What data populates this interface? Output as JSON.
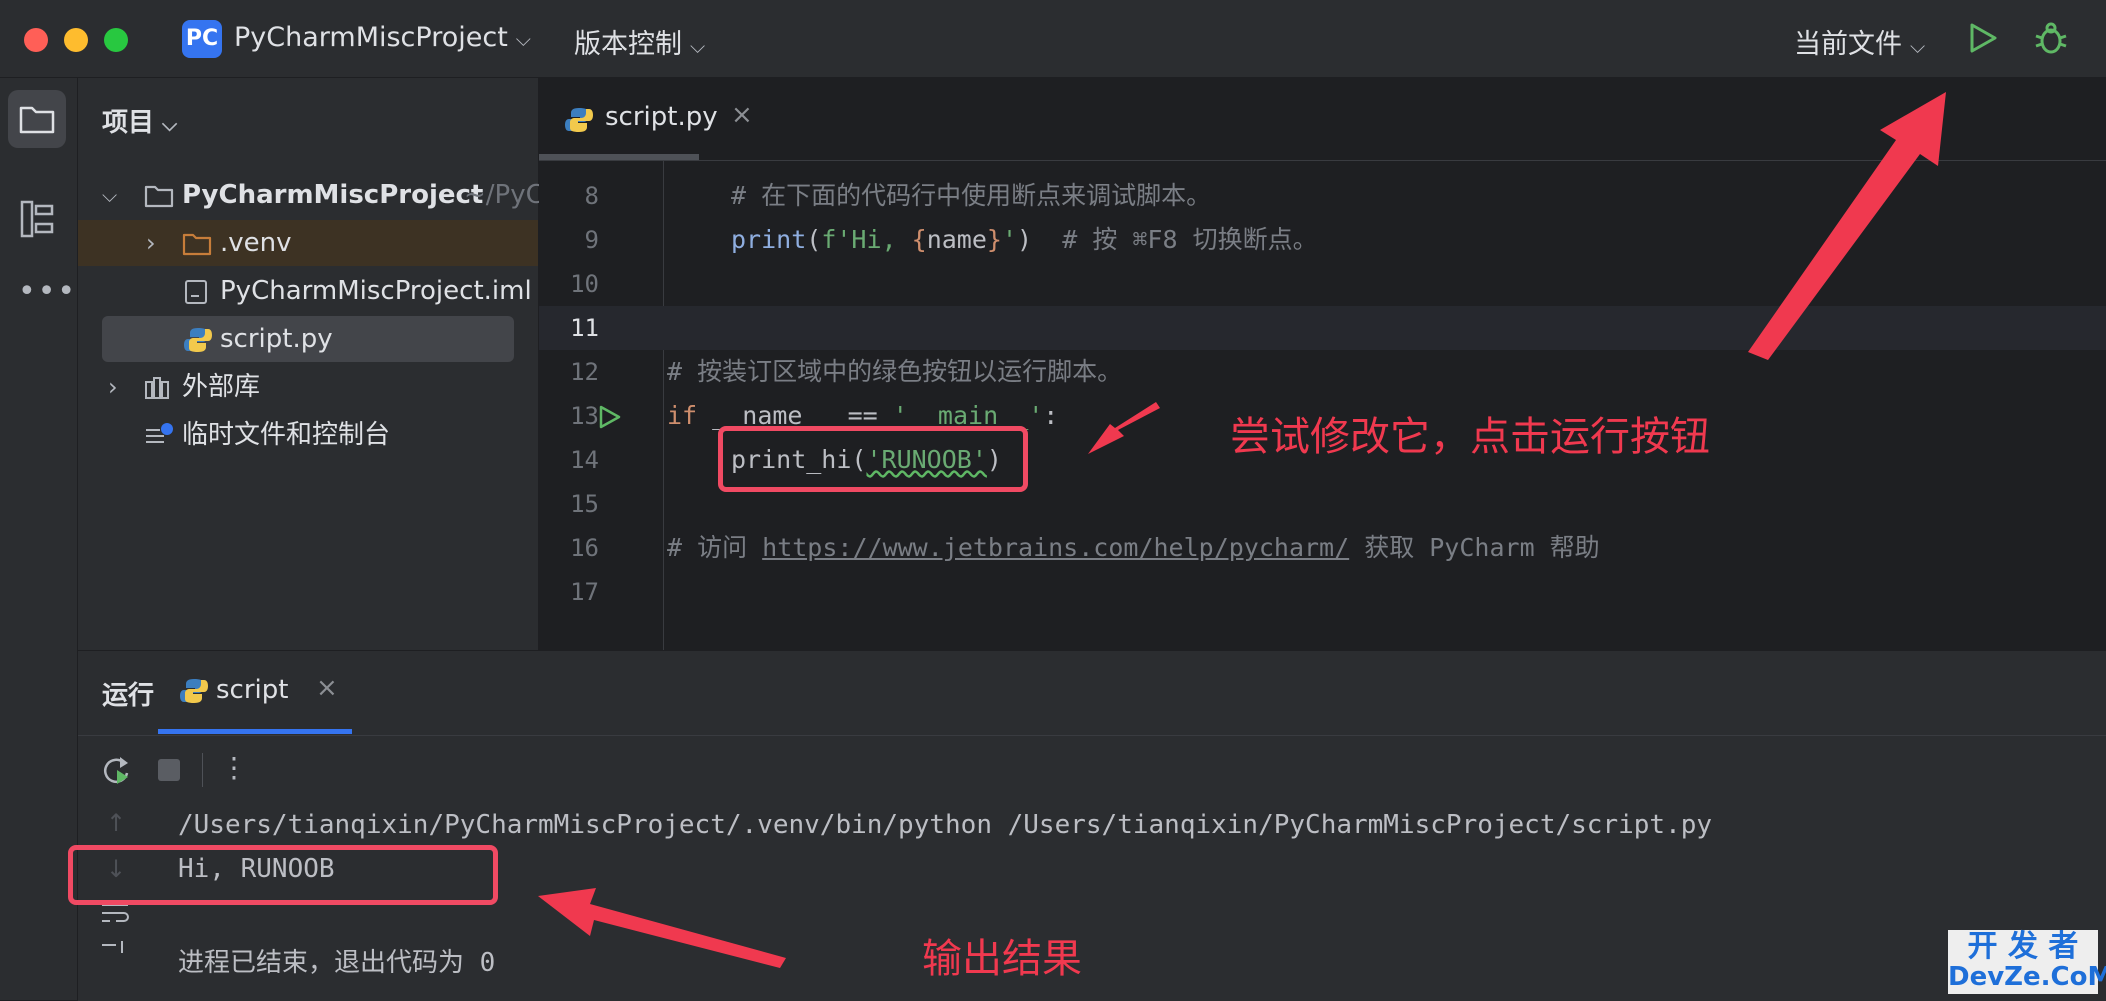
{
  "titlebar": {
    "project_badge": "PC",
    "project_name": "PyCharmMiscProject",
    "vcs_label": "版本控制",
    "run_config": "当前文件"
  },
  "project_panel": {
    "title": "项目",
    "tree": {
      "root_name": "PyCharmMiscProject",
      "root_path": "~/PyC",
      "venv": ".venv",
      "iml_file": "PyCharmMiscProject.iml",
      "script_file": "script.py",
      "external_libs": "外部库",
      "scratches": "临时文件和控制台"
    }
  },
  "editor": {
    "tab_label": "script.py",
    "lines": [
      {
        "num": "8",
        "text": "# 在下面的代码行中使用断点来调试脚本。"
      },
      {
        "num": "9",
        "pre": "print",
        "open": "(",
        "str1": "f'Hi, ",
        "b1": "{",
        "var": "name",
        "b2": "}",
        "str2": "'",
        "close": ")",
        "comment": "  # 按 ⌘F8 切换断点。"
      },
      {
        "num": "10",
        "text": ""
      },
      {
        "num": "11",
        "text": ""
      },
      {
        "num": "12",
        "text": "# 按装订区域中的绿色按钮以运行脚本。"
      },
      {
        "num": "13",
        "kw": "if",
        "rest1": " __name__ == ",
        "str": "'__main__'",
        "rest2": ":"
      },
      {
        "num": "14",
        "fn": "print_hi(",
        "str": "'RUNOOB'",
        "close": ")"
      },
      {
        "num": "15",
        "text": ""
      },
      {
        "num": "16",
        "pre": "# 访问 ",
        "link": "https://www.jetbrains.com/help/pycharm/",
        "post": " 获取 PyCharm 帮助"
      },
      {
        "num": "17",
        "text": ""
      }
    ]
  },
  "run_panel": {
    "title": "运行",
    "tab_label": "script",
    "console": {
      "command": "/Users/tianqixin/PyCharmMiscProject/.venv/bin/python /Users/tianqixin/PyCharmMiscProject/script.py",
      "output": "Hi, RUNOOB",
      "exit_message": "进程已结束，退出代码为 0"
    }
  },
  "annotations": {
    "edit_hint": "尝试修改它，点击运行按钮",
    "output_hint": "输出结果",
    "color": "#f0394f"
  },
  "watermark": {
    "line1": "开 发 者",
    "line2": "DevZe.CoM"
  },
  "colors": {
    "accent": "#3574f0",
    "run_green": "#5fb865",
    "annotation_red": "#f0394f"
  }
}
